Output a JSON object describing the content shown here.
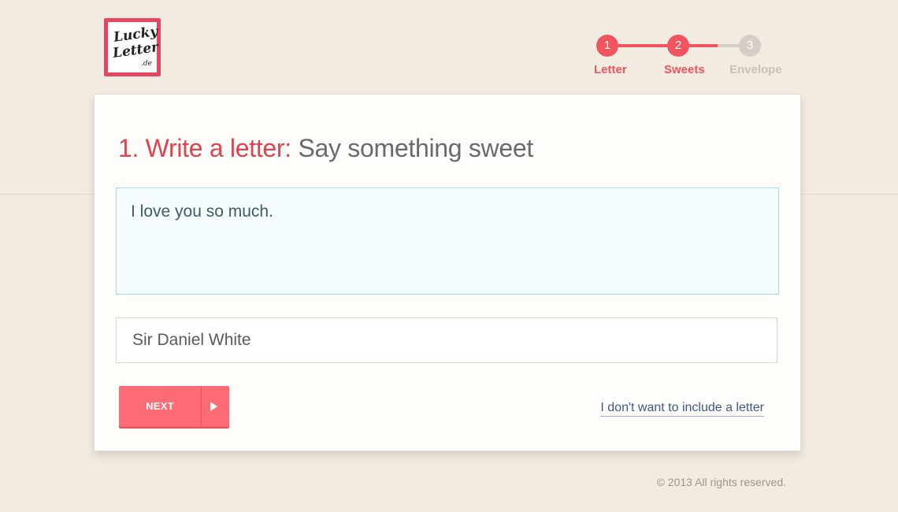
{
  "logo": {
    "line1": "Lucky",
    "line2": "Letter",
    "line3": ".de"
  },
  "steps": [
    {
      "number": "1",
      "label": "Letter",
      "state": "done"
    },
    {
      "number": "2",
      "label": "Sweets",
      "state": "active"
    },
    {
      "number": "3",
      "label": "Envelope",
      "state": "inactive"
    }
  ],
  "form": {
    "heading_prefix": "1. Write a letter:",
    "heading_rest": "Say something sweet",
    "letter_text": "I love you so much.",
    "name_value": "Sir Daniel White",
    "next_label": "NEXT",
    "skip_label": "I don't want to include a letter"
  },
  "footer": {
    "copyright": "© 2013 All rights reserved."
  },
  "colors": {
    "accent": "#f0545f",
    "button": "#fe6b75",
    "background": "#f2ebe2",
    "card": "#fffdf9",
    "inactive": "#d5cec6"
  }
}
